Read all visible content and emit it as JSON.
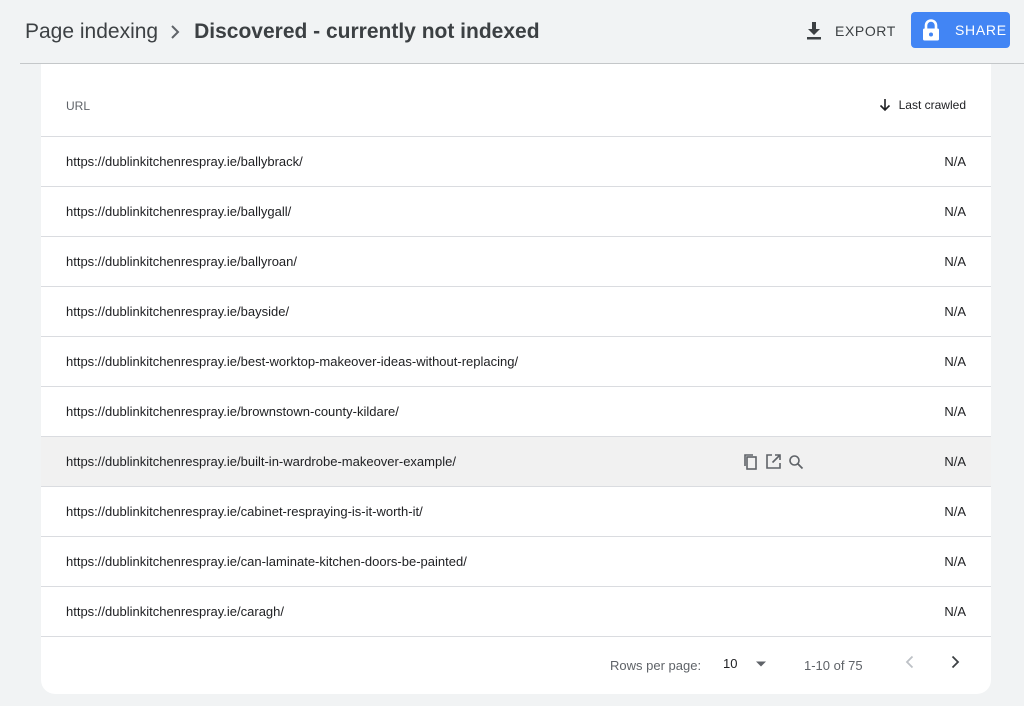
{
  "header": {
    "breadcrumb_parent": "Page indexing",
    "breadcrumb_current": "Discovered - currently not indexed",
    "export_label": "EXPORT",
    "share_label": "SHARE"
  },
  "table": {
    "col_url": "URL",
    "col_last_crawled": "Last crawled",
    "rows": [
      {
        "url": "https://dublinkitchenrespray.ie/ballybrack/",
        "last_crawled": "N/A"
      },
      {
        "url": "https://dublinkitchenrespray.ie/ballygall/",
        "last_crawled": "N/A"
      },
      {
        "url": "https://dublinkitchenrespray.ie/ballyroan/",
        "last_crawled": "N/A"
      },
      {
        "url": "https://dublinkitchenrespray.ie/bayside/",
        "last_crawled": "N/A"
      },
      {
        "url": "https://dublinkitchenrespray.ie/best-worktop-makeover-ideas-without-replacing/",
        "last_crawled": "N/A"
      },
      {
        "url": "https://dublinkitchenrespray.ie/brownstown-county-kildare/",
        "last_crawled": "N/A"
      },
      {
        "url": "https://dublinkitchenrespray.ie/built-in-wardrobe-makeover-example/",
        "last_crawled": "N/A"
      },
      {
        "url": "https://dublinkitchenrespray.ie/cabinet-respraying-is-it-worth-it/",
        "last_crawled": "N/A"
      },
      {
        "url": "https://dublinkitchenrespray.ie/can-laminate-kitchen-doors-be-painted/",
        "last_crawled": "N/A"
      },
      {
        "url": "https://dublinkitchenrespray.ie/caragh/",
        "last_crawled": "N/A"
      }
    ]
  },
  "pagination": {
    "rows_per_page_label": "Rows per page:",
    "rows_per_page_value": "10",
    "range_label": "1-10 of 75"
  },
  "colors": {
    "accent": "#4285f4",
    "background": "#f1f3f4",
    "row_hover": "#f1f1f1"
  }
}
